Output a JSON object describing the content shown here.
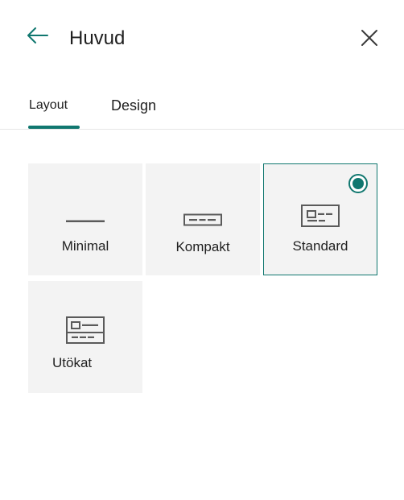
{
  "header": {
    "title": "Huvud",
    "back_icon": "arrow-left-icon",
    "close_icon": "close-icon"
  },
  "tabs": [
    {
      "label": "Layout",
      "active": true
    },
    {
      "label": "Design",
      "active": false
    }
  ],
  "layouts": [
    {
      "label": "Minimal",
      "icon": "header-minimal-icon",
      "selected": false
    },
    {
      "label": "Kompakt",
      "icon": "header-compact-icon",
      "selected": false
    },
    {
      "label": "Standard",
      "icon": "header-standard-icon",
      "selected": true
    },
    {
      "label": "Utökat",
      "icon": "header-extended-icon",
      "selected": false
    }
  ],
  "colors": {
    "accent": "#10776f",
    "tile_background": "#f3f3f3",
    "icon": "#5a5a5a"
  }
}
